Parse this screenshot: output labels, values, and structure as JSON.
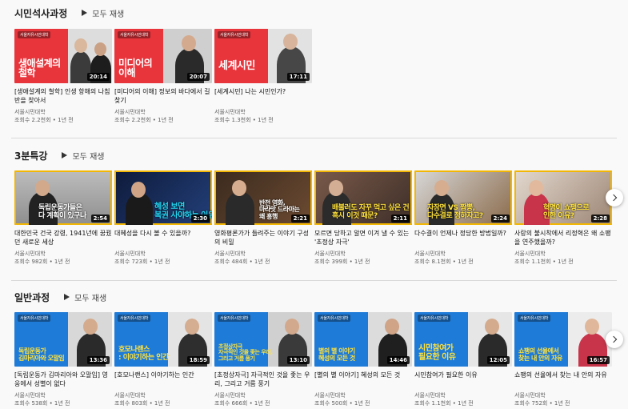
{
  "play_all_label": "모두 재생",
  "sections": [
    {
      "title": "시민석사과정",
      "videos": [
        {
          "thumb_text": "생애설계의\n철학",
          "duration": "20:14",
          "title": "[생애설계의 철학] 인생 항해의 나침반을 찾아서",
          "channel": "서울시민대학",
          "meta": "조회수 2.2천회 • 1년 전"
        },
        {
          "thumb_text": "미디어의\n이해",
          "duration": "20:07",
          "title": "[미디어의 이해] 정보의 바다에서 길 찾기",
          "channel": "서울시민대학",
          "meta": "조회수 2.2천회 • 1년 전"
        },
        {
          "thumb_text": "세계시민",
          "duration": "17:11",
          "title": "[세계시민] 나는 시민인가?",
          "channel": "서울시민대학",
          "meta": "조회수 1.3천회 • 1년 전"
        }
      ]
    },
    {
      "title": "3분특강",
      "videos": [
        {
          "thumb_text": "독립운동가들은\n다 계획이 있구나",
          "duration": "2:54",
          "title": "대한민국 건국 강령, 1941년에 꿈꿨던 새로운 세상",
          "channel": "서울시민대학",
          "meta": "조회수 982회 • 1년 전"
        },
        {
          "thumb_text": "혜성 보면\n복권 사야하는 이유",
          "duration": "2:30",
          "title": "대혜성을 다시 볼 수 있을까?",
          "channel": "서울시민대학",
          "meta": "조회수 723회 • 1년 전"
        },
        {
          "thumb_text": "반전 영화,\n마라맛 드라마는\n왜 흥행",
          "duration": "2:21",
          "title": "영화평론가가 들려주는 이야기 구성의 비밀",
          "channel": "서울시민대학",
          "meta": "조회수 484회 • 1년 전"
        },
        {
          "thumb_text": "배불러도 자꾸 먹고 싶은 건\n혹시 이것 때문?",
          "duration": "2:11",
          "title": "모르면 당하고 알면 이겨 낼 수 있는 '초정상 자극'",
          "channel": "서울시민대학",
          "meta": "조회수 399회 • 1년 전"
        },
        {
          "thumb_text": "자장면 VS 짬뽕,\n다수결로 정하자고?",
          "duration": "2:24",
          "title": "다수결이 언제나 정당한 방법일까?",
          "channel": "서울시민대학",
          "meta": "조회수 8.1천회 • 1년 전"
        },
        {
          "thumb_text": "혁명이 쇼팽으로\n인한 이유?",
          "duration": "2:28",
          "title": "사랑의 불시착에서 리정혁은 왜 쇼팽을 연주했을까?",
          "channel": "서울시민대학",
          "meta": "조회수 1.1천회 • 1년 전"
        }
      ]
    },
    {
      "title": "일반과정",
      "videos": [
        {
          "thumb_text": "독립운동가\n김마리아와 오말임",
          "duration": "13:36",
          "title": "[독립운동가 김마리아와 오말임] 영웅에서 성별이 없다",
          "channel": "서울시민대학",
          "meta": "조회수 538회 • 1년 전"
        },
        {
          "thumb_text": "호모나랜스\n: 이야기하는 인간",
          "duration": "18:59",
          "title": "[호모나랜스] 이야기하는 인간",
          "channel": "서울시민대학",
          "meta": "조회수 803회 • 1년 전"
        },
        {
          "thumb_text": "초정상자극\n자극적인 것을 좇는 우리,\n그리고 거름 풍기",
          "duration": "13:10",
          "title": "[초정상자극] 자극적인 것을 좇는 우리, 그리고 거름 풍기",
          "channel": "서울시민대학",
          "meta": "조회수 666회 • 1년 전"
        },
        {
          "thumb_text": "별의 별 이야기\n혜성의 모든 것",
          "duration": "14:46",
          "title": "[별의 별 이야기] 혜성의 모든 것",
          "channel": "서울시민대학",
          "meta": "조회수 500회 • 1년 전"
        },
        {
          "thumb_text": "시민참여가\n필요한 이유",
          "duration": "12:05",
          "title": "시민참여가 필요한 이유",
          "channel": "서울시민대학",
          "meta": "조회수 1.1천회 • 1년 전"
        },
        {
          "thumb_text": "쇼팽의 선율에서\n찾는 내 안의 자유",
          "duration": "16:57",
          "title": "쇼팽의 선율에서 찾는 내 안의 자유",
          "channel": "서울시민대학",
          "meta": "조회수 752회 • 1년 전"
        }
      ]
    }
  ],
  "thumb_brand": "서울자유시민대학",
  "colors": {
    "accent_red": "#e8353c",
    "accent_blue": "#1f7bd8",
    "cyan_text": "#23d5f2",
    "yellow_text": "#ffe23b"
  }
}
